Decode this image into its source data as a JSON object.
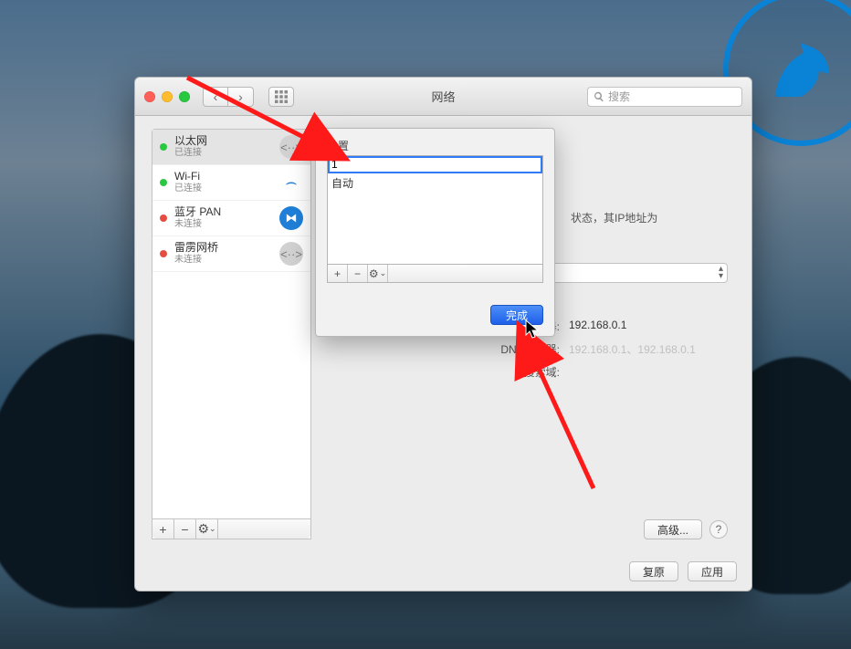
{
  "watermark": {
    "icon": "horse-emblem-icon"
  },
  "window": {
    "title": "网络",
    "search_placeholder": "搜索",
    "location_stub": "位",
    "advanced_button": "高级...",
    "help_symbol": "?",
    "revert_button": "复原",
    "apply_button": "应用"
  },
  "sidebar": {
    "items": [
      {
        "name": "以太网",
        "status": "已连接",
        "status_color": "green",
        "icon": "ethernet-icon",
        "selected": true
      },
      {
        "name": "Wi-Fi",
        "status": "已连接",
        "status_color": "green",
        "icon": "wifi-icon",
        "selected": false
      },
      {
        "name": "蓝牙 PAN",
        "status": "未连接",
        "status_color": "red",
        "icon": "bluetooth-icon",
        "selected": false
      },
      {
        "name": "雷雳网桥",
        "status": "未连接",
        "status_color": "red",
        "icon": "thunderbolt-icon",
        "selected": false
      }
    ],
    "toolbar": {
      "add": "+",
      "remove": "−",
      "gear": "⚙"
    }
  },
  "main": {
    "status_tail": "状态，其IP地址为",
    "fields": {
      "router_label": "路由器:",
      "router_value": "192.168.0.1",
      "dns_label": "DNS服务器:",
      "dns_value": "192.168.0.1、192.168.0.1",
      "search_domain_label": "搜索域:",
      "search_domain_value": ""
    }
  },
  "sheet": {
    "label": "位置",
    "input_value": "1",
    "rows": [
      "自动"
    ],
    "toolbar": {
      "add": "+",
      "remove": "−",
      "gear": "⚙",
      "chevron": "⌄"
    },
    "done_button": "完成"
  }
}
